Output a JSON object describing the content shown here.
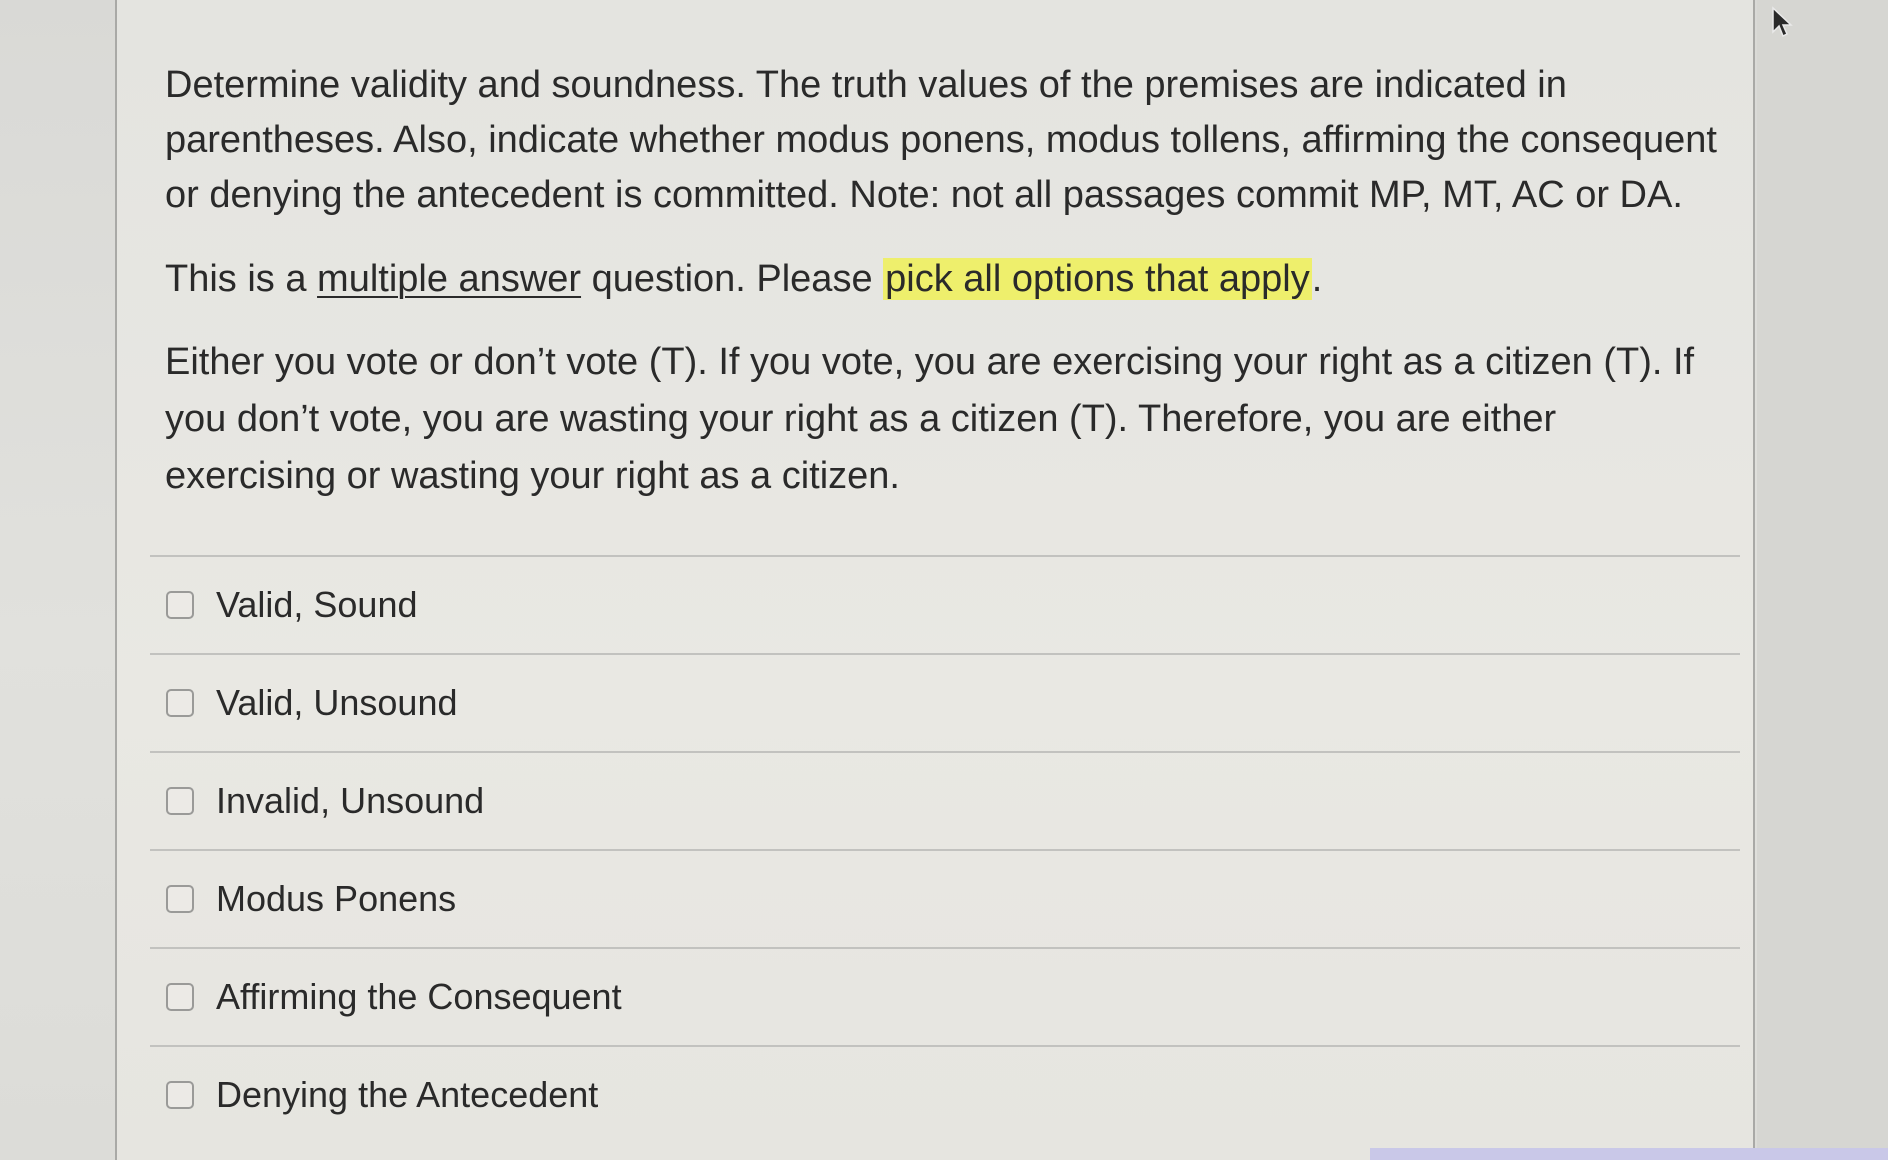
{
  "question": {
    "instructions": "Determine validity and soundness. The truth values of the premises are indicated in parentheses. Also, indicate whether modus ponens, modus tollens, affirming the consequent or denying the antecedent is committed.  Note: not all passages commit MP, MT, AC or DA.",
    "multi_prefix": "This is a ",
    "multi_underlined": "multiple answer",
    "multi_middle": " question. Please ",
    "multi_highlighted": "pick all options that apply",
    "multi_suffix": ".",
    "argument": "Either you vote or don’t vote (T). If you vote, you are exercising your right as a citizen (T). If you don’t vote, you are wasting your right as a citizen (T). Therefore, you are either exercising or wasting your right as a citizen."
  },
  "options": [
    {
      "label": "Valid, Sound",
      "checked": false
    },
    {
      "label": "Valid, Unsound",
      "checked": false
    },
    {
      "label": "Invalid, Unsound",
      "checked": false
    },
    {
      "label": "Modus Ponens",
      "checked": false
    },
    {
      "label": "Affirming the Consequent",
      "checked": false
    },
    {
      "label": "Denying the Antecedent",
      "checked": false
    }
  ],
  "colors": {
    "highlight": "#eeef6c",
    "panel": "#e6e5e0",
    "text": "#2a2a2a"
  },
  "icons": {
    "cursor": "mouse-pointer-icon",
    "checkbox": "checkbox-icon"
  }
}
